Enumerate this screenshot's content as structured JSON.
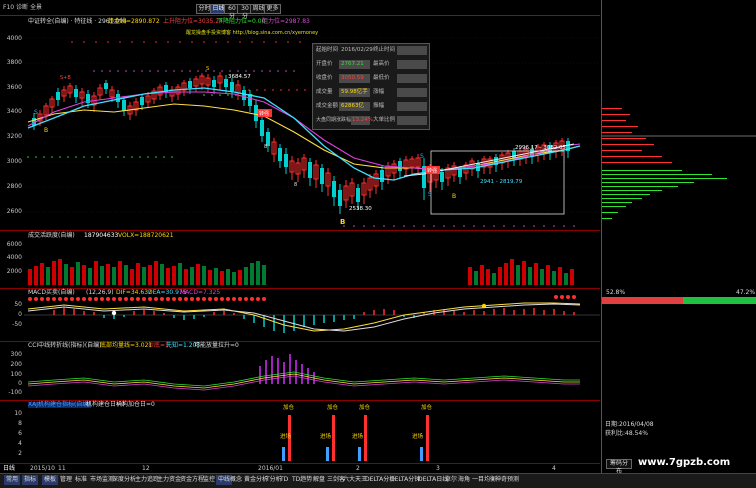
{
  "toolbar": {
    "left_items": [
      "F10",
      "诊断",
      "全景"
    ],
    "period_buttons": [
      "分时",
      "日线",
      "60分",
      "30分",
      "周线",
      "更多"
    ],
    "active_period": "日线"
  },
  "main_chart": {
    "title": "中证转全(自编) · 特征线 · 2961.094",
    "indicator_1": "趋金线=2890.872",
    "indicator_2": "上升阻力位=3035.24",
    "indicator_3": "下降阻力位=0.00",
    "indicator_4": "阻力位=2987.83",
    "watermark": "醒龙操盘手投资博客 http://blog.sina.com.cn/xyemoney",
    "y_ticks": [
      "4000",
      "3800",
      "3600",
      "3400",
      "3200",
      "3000",
      "2800",
      "2600"
    ],
    "annotations": [
      "3684.57",
      "2538.30",
      "2996.17 - 3082.05",
      "2941 - 2819.79"
    ],
    "signal_letters": [
      "S",
      "B",
      "S",
      "B",
      "S",
      "B",
      "B"
    ]
  },
  "info_box": {
    "rows": [
      {
        "label": "起始时间",
        "value": "2016/02/29",
        "label2": "终止时间",
        "value2": ""
      },
      {
        "label": "开盘价",
        "value": "2767.21",
        "label2": "最高价",
        "value2": ""
      },
      {
        "label": "收盘价",
        "value": "3050.59",
        "label2": "最低价",
        "value2": ""
      },
      {
        "label": "成交量",
        "value": "59.98亿手",
        "label2": "涨幅",
        "value2": ""
      },
      {
        "label": "成交金额",
        "value": "62863亿",
        "label2": "振幅",
        "value2": ""
      },
      {
        "label": "大盘同期涨跌幅",
        "value": "13.24%",
        "label2": "大单比例",
        "value2": ""
      }
    ]
  },
  "volume_panel": {
    "title": "成交活跃度(自编)",
    "value": "187904633",
    "vol_label": "VOLX=188720621",
    "y_ticks": [
      "6000",
      "4000",
      "2000"
    ],
    "annotation": "放量"
  },
  "macd_panel": {
    "title": "MACD买卖(自编)",
    "params": "(12,26,9)",
    "dif": "DIF=34.637",
    "dea": "DEA=30.975",
    "macd": "MACD=7.325",
    "y_ticks": [
      "50",
      "0",
      "-50"
    ]
  },
  "cci_panel": {
    "title": "CCI中线转折线(指标)(自编)",
    "l1": "底部均量线=3.021",
    "l2": "抄底=1",
    "l3": "先知=1.203",
    "l4": "可能放量拉升=0",
    "y_ticks": [
      "300",
      "200",
      "100",
      "0",
      "-100"
    ]
  },
  "bottom_panel": {
    "title": "XAJ机构建仓指标(自编)",
    "l1": "机构建仓日=0",
    "l2": "机构加仓日=0",
    "y_ticks": [
      "10",
      "8",
      "6",
      "4",
      "2"
    ],
    "labels_top": [
      "加仓",
      "加仓",
      "加仓",
      "加仓"
    ],
    "labels_mid": [
      "进场",
      "进场",
      "进场",
      "进场"
    ]
  },
  "x_axis": {
    "labels": [
      "2015/10",
      "11",
      "12",
      "2016/01",
      "2",
      "3",
      "4"
    ],
    "left_tag": "日线"
  },
  "right_panel": {
    "pct_left": "52.8%",
    "pct_right": "47.2%",
    "date": "日期:2016/04/08",
    "profit": "获利比:48.54%",
    "btn": "筹码分布"
  },
  "bottom_tabs": [
    "常用",
    "指标",
    "模板",
    "管理",
    "标准",
    "市场监测",
    "深度分析",
    "主力追踪",
    "主力资金",
    "资金方程",
    "监控",
    "中线",
    "概念",
    "黄金分析",
    "T分析",
    "TD",
    "TD趋势",
    "解盘",
    "三剑客",
    "六大天王",
    "DELTA分析",
    "DELTA分钟",
    "DELTA日线",
    "卓尔",
    "海角",
    "一目均衡",
    "神奇预测"
  ],
  "active_tab": "中线",
  "website": "www.7gpzb.com"
}
